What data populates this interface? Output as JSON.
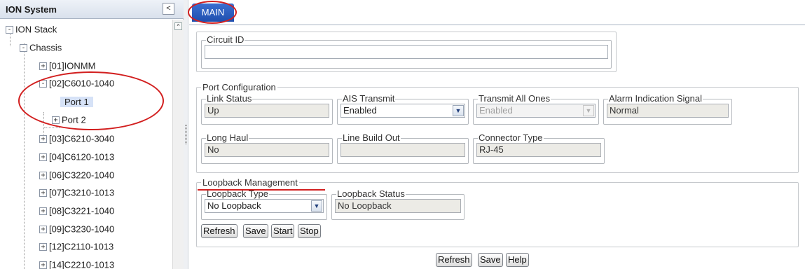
{
  "left_panel": {
    "title": "ION System",
    "collapse_glyph": "<",
    "scroll_up_glyph": "^",
    "tree": [
      {
        "label": "ION Stack",
        "level": 0,
        "toggle": "-"
      },
      {
        "label": "Chassis",
        "level": 1,
        "toggle": "-"
      },
      {
        "label": "[01]IONMM",
        "level": 2,
        "toggle": "+"
      },
      {
        "label": "[02]C6010-1040",
        "level": 2,
        "toggle": "-"
      },
      {
        "label": "Port 1",
        "level": 3,
        "toggle": "",
        "selected": true
      },
      {
        "label": "Port 2",
        "level": 3,
        "toggle": "+"
      },
      {
        "label": "[03]C6210-3040",
        "level": 2,
        "toggle": "+"
      },
      {
        "label": "[04]C6120-1013",
        "level": 2,
        "toggle": "+"
      },
      {
        "label": "[06]C3220-1040",
        "level": 2,
        "toggle": "+"
      },
      {
        "label": "[07]C3210-1013",
        "level": 2,
        "toggle": "+"
      },
      {
        "label": "[08]C3221-1040",
        "level": 2,
        "toggle": "+"
      },
      {
        "label": "[09]C3230-1040",
        "level": 2,
        "toggle": "+"
      },
      {
        "label": "[12]C2110-1013",
        "level": 2,
        "toggle": "+"
      },
      {
        "label": "[14]C2210-1013",
        "level": 2,
        "toggle": "+"
      }
    ]
  },
  "tabs": [
    {
      "label": "MAIN",
      "active": true
    }
  ],
  "circuit": {
    "legend": "Circuit ID",
    "value": ""
  },
  "port_config": {
    "legend": "Port Configuration",
    "link_status": {
      "label": "Link Status",
      "value": "Up"
    },
    "ais_transmit": {
      "label": "AIS Transmit",
      "value": "Enabled"
    },
    "transmit_all_ones": {
      "label": "Transmit All Ones",
      "value": "Enabled",
      "disabled": true
    },
    "alarm_indication": {
      "label": "Alarm Indication Signal",
      "value": "Normal"
    },
    "long_haul": {
      "label": "Long Haul",
      "value": "No"
    },
    "line_build_out": {
      "label": "Line Build Out",
      "value": ""
    },
    "connector_type": {
      "label": "Connector Type",
      "value": "RJ-45"
    }
  },
  "loopback": {
    "legend": "Loopback Management",
    "type": {
      "label": "Loopback Type",
      "value": "No Loopback"
    },
    "status": {
      "label": "Loopback Status",
      "value": "No Loopback"
    },
    "buttons": {
      "refresh": "Refresh",
      "save": "Save",
      "start": "Start",
      "stop": "Stop"
    }
  },
  "footer_buttons": {
    "refresh": "Refresh",
    "save": "Save",
    "help": "Help"
  },
  "icons": {
    "dropdown": "chevron-down-icon",
    "expand": "plus-icon",
    "collapse": "minus-icon"
  },
  "colors": {
    "tab_active": "#2456bf",
    "annotation": "#d21f1f",
    "selected_node": "#d6e2f7"
  }
}
